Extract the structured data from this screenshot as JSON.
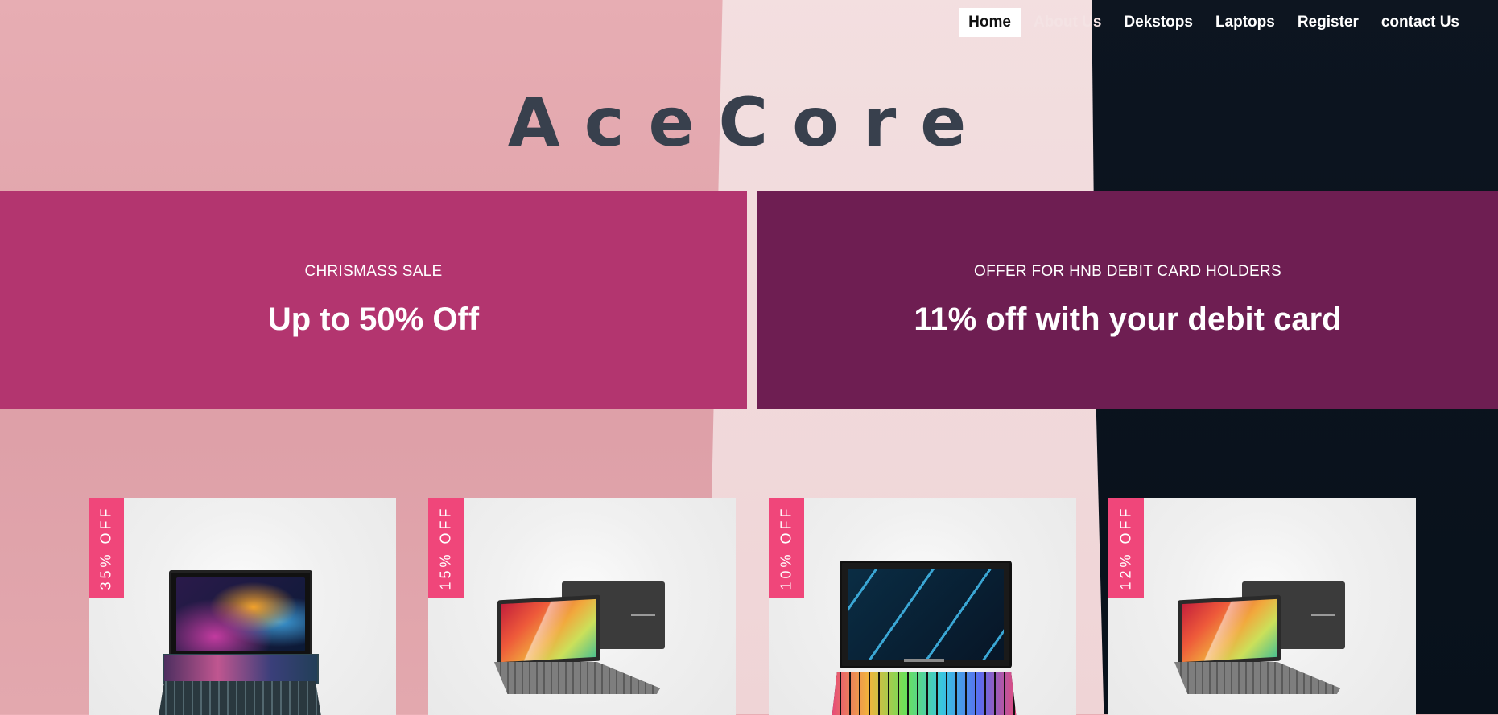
{
  "nav": {
    "items": [
      {
        "label": "Home",
        "active": true
      },
      {
        "label": "About Us",
        "active": false
      },
      {
        "label": "Dekstops",
        "active": false
      },
      {
        "label": "Laptops",
        "active": false
      },
      {
        "label": "Register",
        "active": false
      },
      {
        "label": "contact Us",
        "active": false
      }
    ]
  },
  "brand": {
    "title": "AceCore"
  },
  "promos": [
    {
      "kicker": "CHRISMASS SALE",
      "headline": "Up to 50% Off",
      "color": "#b3356f"
    },
    {
      "kicker": "OFFER FOR HNB DEBIT CARD HOLDERS",
      "headline": "11% off with your debit card",
      "color": "#6e1e52"
    }
  ],
  "products": [
    {
      "discount": "35% OFF",
      "image": "asus-zenbook-duo-laptop"
    },
    {
      "discount": "15% OFF",
      "image": "asus-vivobook-laptop"
    },
    {
      "discount": "10% OFF",
      "image": "acer-predator-laptop"
    },
    {
      "discount": "12% OFF",
      "image": "asus-vivobook-laptop"
    }
  ],
  "colors": {
    "accent_tag": "#f0467a",
    "brand_text": "#38404d"
  }
}
